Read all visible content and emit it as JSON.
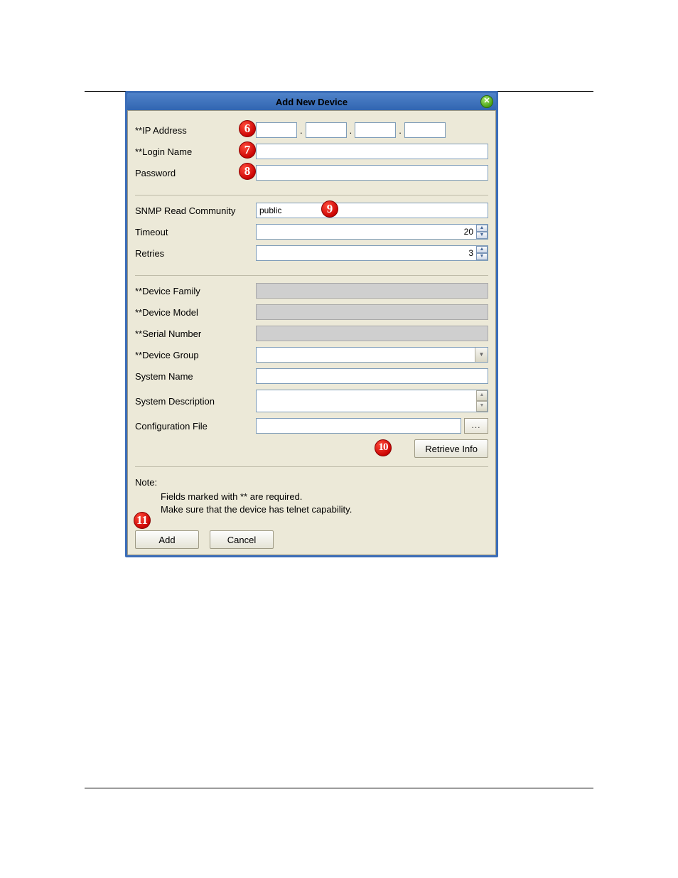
{
  "dialog": {
    "title": "Add New Device"
  },
  "fields": {
    "ip_address_label": "**IP Address",
    "login_name_label": "**Login Name",
    "login_name_value": "",
    "password_label": "Password",
    "password_value": "",
    "snmp_label": "SNMP Read Community",
    "snmp_value": "public",
    "timeout_label": "Timeout",
    "timeout_value": "20",
    "retries_label": "Retries",
    "retries_value": "3",
    "device_family_label": "**Device Family",
    "device_family_value": "",
    "device_model_label": "**Device Model",
    "device_model_value": "",
    "serial_number_label": "**Serial Number",
    "serial_number_value": "",
    "device_group_label": "**Device Group",
    "device_group_value": "",
    "system_name_label": "System Name",
    "system_name_value": "",
    "system_description_label": "System Description",
    "system_description_value": "",
    "configuration_file_label": "Configuration File",
    "configuration_file_value": ""
  },
  "buttons": {
    "browse": "...",
    "retrieve": "Retrieve Info",
    "add": "Add",
    "cancel": "Cancel"
  },
  "note": {
    "title": "Note:",
    "line1": "Fields marked with ** are required.",
    "line2": "Make sure that the device has telnet capability."
  },
  "callouts": {
    "c6": "6",
    "c7": "7",
    "c8": "8",
    "c9": "9",
    "c10": "10",
    "c11": "11"
  }
}
